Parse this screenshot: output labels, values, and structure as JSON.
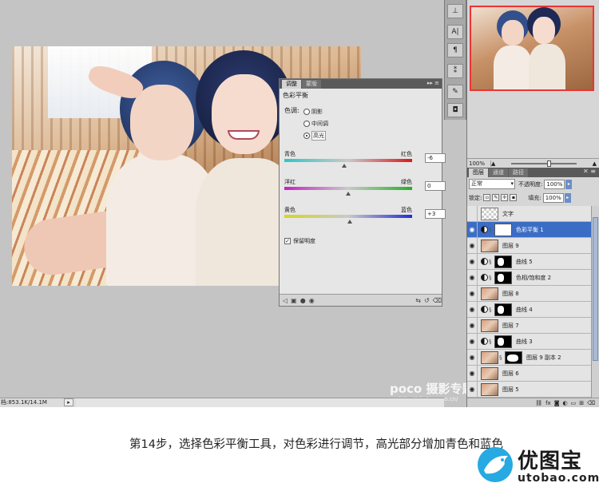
{
  "adjustments_panel": {
    "tabs": [
      "调整",
      "蒙版"
    ],
    "title": "色彩平衡",
    "tone_label": "色调:",
    "tones": [
      "阴影",
      "中间调",
      "高光"
    ],
    "selected_tone": "高光",
    "sliders": [
      {
        "left": "青色",
        "right": "红色",
        "value": "-6",
        "level": -6
      },
      {
        "left": "洋红",
        "right": "绿色",
        "value": "0",
        "level": 0
      },
      {
        "left": "黄色",
        "right": "蓝色",
        "value": "+3",
        "level": 3
      }
    ],
    "preserve_luminosity": "保留明度",
    "preserve_checked": true
  },
  "status_bar": {
    "doc_size": "档:853.1K/14.1M"
  },
  "watermark": {
    "brand": "poco 摄影专题",
    "url": "http://photo.poco.cn/"
  },
  "navigator": {
    "zoom": "100%"
  },
  "layers_panel": {
    "tabs": [
      "图层",
      "通道",
      "路径"
    ],
    "blend_mode": "正常",
    "opacity_label": "不透明度:",
    "opacity": "100%",
    "lock_label": "锁定:",
    "fill_label": "填充:",
    "fill": "100%",
    "layers": [
      {
        "name": "文字",
        "thumb": "trans",
        "visible": false,
        "adjust": false,
        "selected": false
      },
      {
        "name": "色彩平衡 1",
        "thumb": "mask-white",
        "visible": true,
        "adjust": true,
        "selected": true
      },
      {
        "name": "图层 9",
        "thumb": "photo",
        "visible": true,
        "adjust": false,
        "selected": false
      },
      {
        "name": "曲线 5",
        "thumb": "mask",
        "visible": true,
        "adjust": true,
        "selected": false
      },
      {
        "name": "色相/饱和度 2",
        "thumb": "mask",
        "visible": true,
        "adjust": true,
        "selected": false
      },
      {
        "name": "图层 8",
        "thumb": "photo",
        "visible": true,
        "adjust": false,
        "selected": false
      },
      {
        "name": "曲线 4",
        "thumb": "mask",
        "visible": true,
        "adjust": true,
        "selected": false
      },
      {
        "name": "图层 7",
        "thumb": "photo",
        "visible": true,
        "adjust": false,
        "selected": false
      },
      {
        "name": "曲线 3",
        "thumb": "mask",
        "visible": true,
        "adjust": true,
        "selected": false
      },
      {
        "name": "图层 9 副本 2",
        "thumb": "photo+mask",
        "visible": true,
        "adjust": false,
        "selected": false
      },
      {
        "name": "图层 6",
        "thumb": "photo",
        "visible": true,
        "adjust": false,
        "selected": false
      },
      {
        "name": "图层 5",
        "thumb": "photo",
        "visible": true,
        "adjust": false,
        "selected": false
      }
    ]
  },
  "caption": {
    "text": "第14步，选择色彩平衡工具，对色彩进行调节，高光部分增加青色和蓝色"
  },
  "logo": {
    "name": "优图宝",
    "url": "utobao.com"
  }
}
